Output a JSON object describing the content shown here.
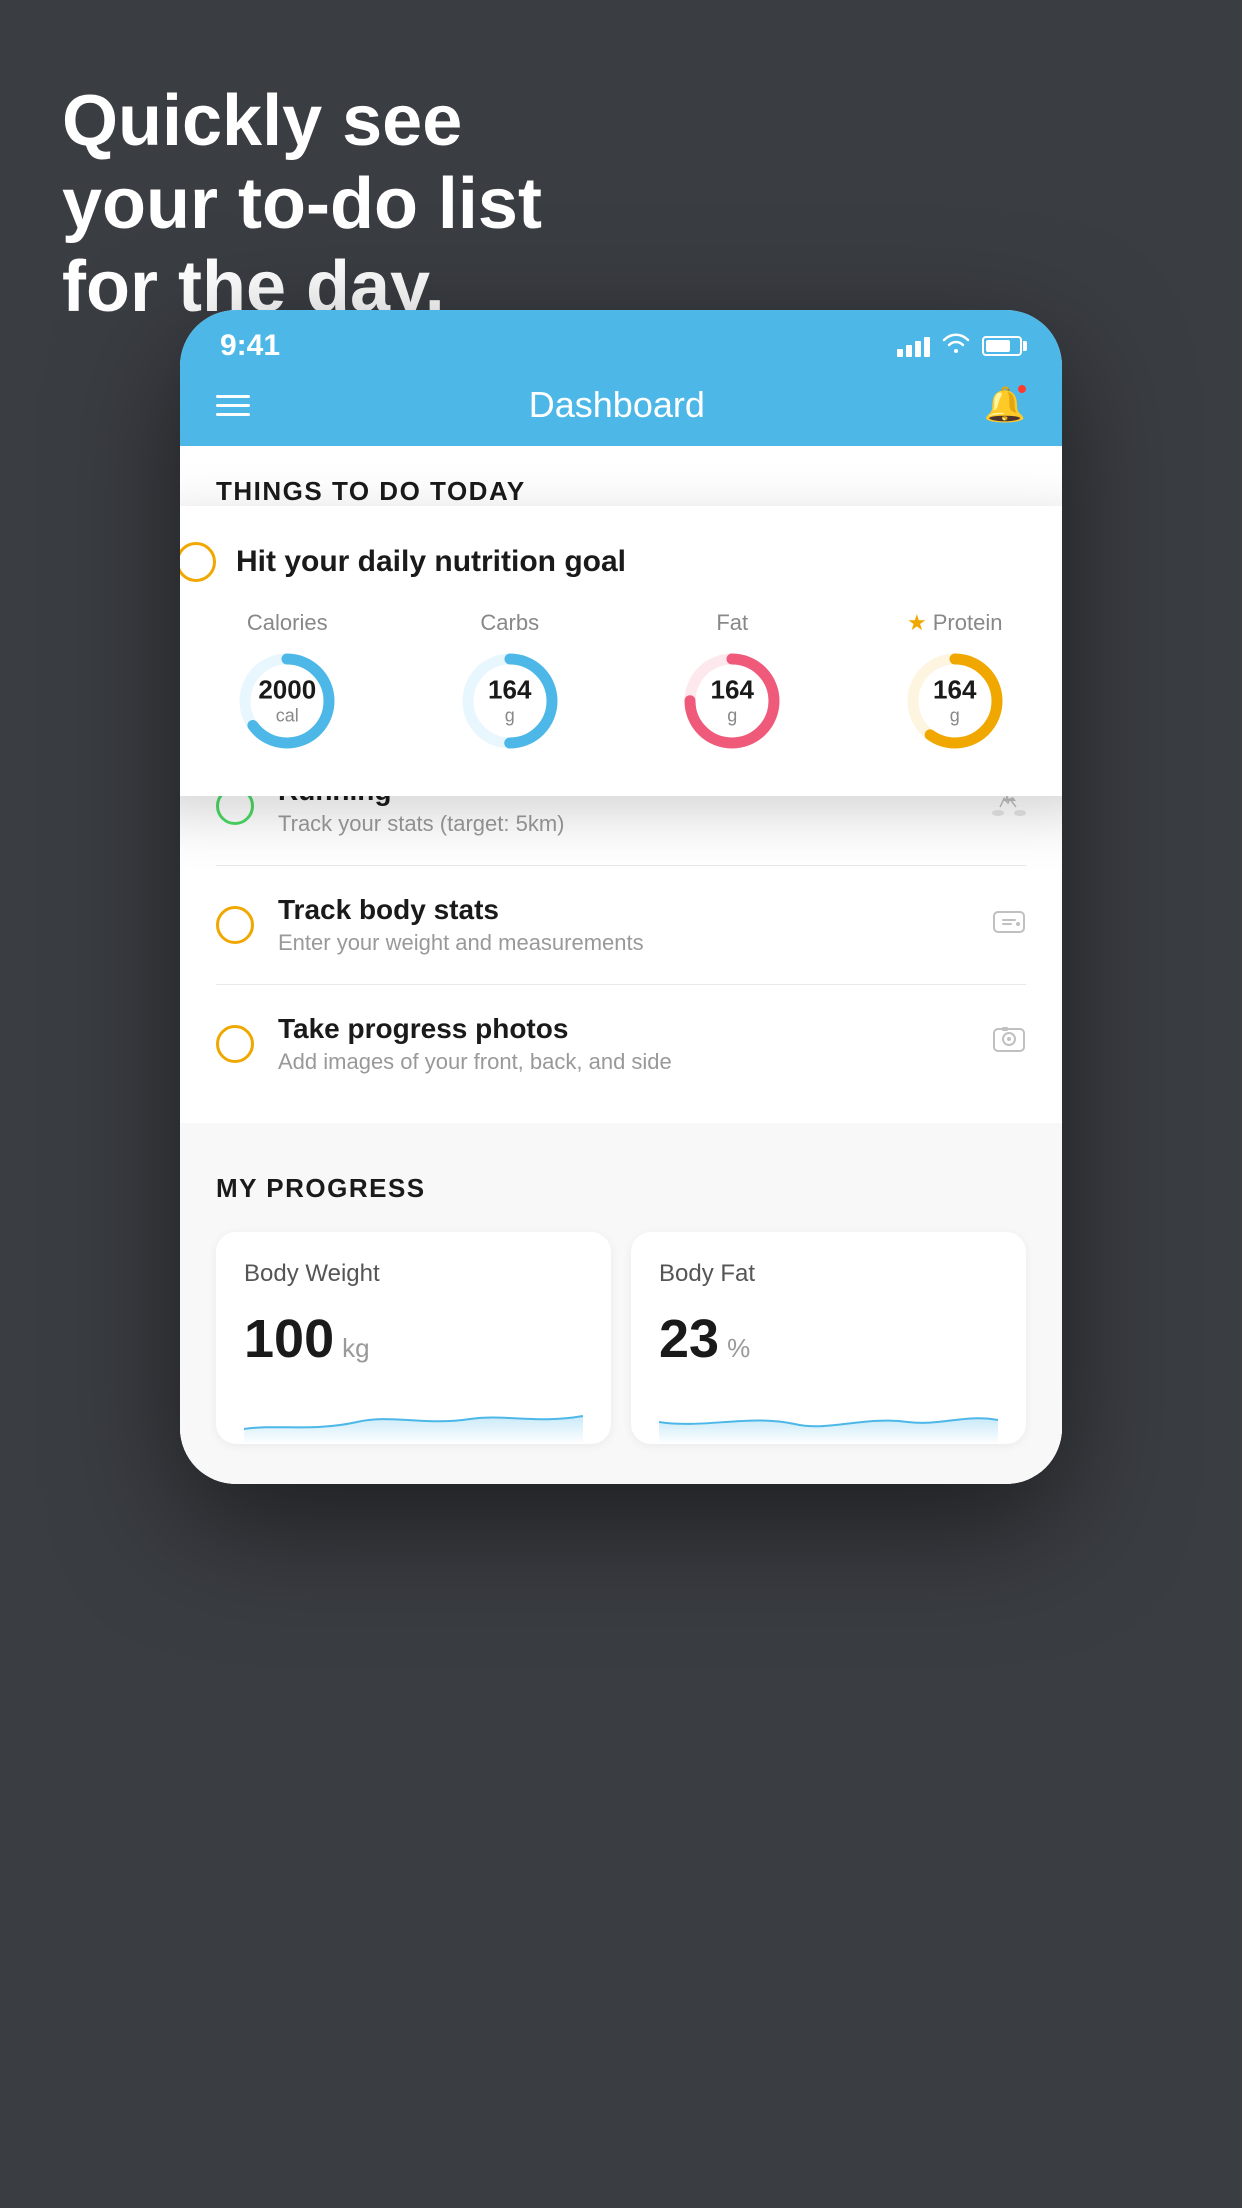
{
  "headline": {
    "line1": "Quickly see",
    "line2": "your to-do list",
    "line3": "for the day."
  },
  "statusBar": {
    "time": "9:41",
    "batteryLevel": 75
  },
  "navBar": {
    "title": "Dashboard"
  },
  "thingsToDo": {
    "heading": "THINGS TO DO TODAY",
    "floatingCard": {
      "title": "Hit your daily nutrition goal",
      "items": [
        {
          "label": "Calories",
          "value": "2000",
          "unit": "cal",
          "color": "#4db8e8",
          "bg": "#e8f6fd",
          "progress": 65,
          "star": false
        },
        {
          "label": "Carbs",
          "value": "164",
          "unit": "g",
          "color": "#4db8e8",
          "bg": "#e8f6fd",
          "progress": 50,
          "star": false
        },
        {
          "label": "Fat",
          "value": "164",
          "unit": "g",
          "color": "#f05a7a",
          "bg": "#fde8ed",
          "progress": 75,
          "star": false
        },
        {
          "label": "Protein",
          "value": "164",
          "unit": "g",
          "color": "#f0a800",
          "bg": "#fdf5e0",
          "progress": 60,
          "star": true
        }
      ]
    },
    "todoItems": [
      {
        "name": "Running",
        "sub": "Track your stats (target: 5km)",
        "circleColor": "green",
        "icon": "👟"
      },
      {
        "name": "Track body stats",
        "sub": "Enter your weight and measurements",
        "circleColor": "yellow",
        "icon": "⚖"
      },
      {
        "name": "Take progress photos",
        "sub": "Add images of your front, back, and side",
        "circleColor": "yellow",
        "icon": "🪪"
      }
    ]
  },
  "myProgress": {
    "heading": "MY PROGRESS",
    "cards": [
      {
        "title": "Body Weight",
        "value": "100",
        "unit": "kg"
      },
      {
        "title": "Body Fat",
        "value": "23",
        "unit": "%"
      }
    ]
  }
}
